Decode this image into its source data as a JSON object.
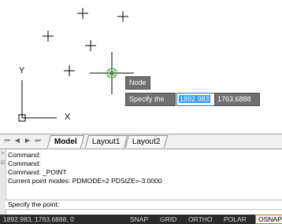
{
  "drawing": {
    "ucs_y_label": "Y",
    "ucs_x_label": "X",
    "snap_tooltip": "Node",
    "prompt_label": "Specify the point:",
    "input_x_value": "1892.983",
    "input_y_value": "1763.6888"
  },
  "layout_tabs": {
    "nav_icons": [
      "first-icon",
      "prev-icon",
      "next-icon",
      "last-icon"
    ],
    "tabs": [
      {
        "label": "Model",
        "active": true
      },
      {
        "label": "Layout1",
        "active": false
      },
      {
        "label": "Layout2",
        "active": false
      }
    ]
  },
  "command_window": {
    "history": [
      "Command:",
      "Command:",
      "Command: _POINT",
      "Current point modes:  PDMODE=2  PDSIZE=-3.0000"
    ],
    "prompt": "Specify the point:"
  },
  "status_bar": {
    "coordinates": "1892.983, 1763.6888, 0",
    "toggles": [
      {
        "label": "SNAP",
        "on": false
      },
      {
        "label": "GRID",
        "on": false
      },
      {
        "label": "ORTHO",
        "on": false
      },
      {
        "label": "POLAR",
        "on": false
      },
      {
        "label": "OSNAP",
        "on": true
      }
    ]
  },
  "colors": {
    "canvas_bg": "#ffffff",
    "snap_marker": "#33a833",
    "status_bar_bg": "#2b2b2b",
    "osnap_border": "#e07000"
  }
}
